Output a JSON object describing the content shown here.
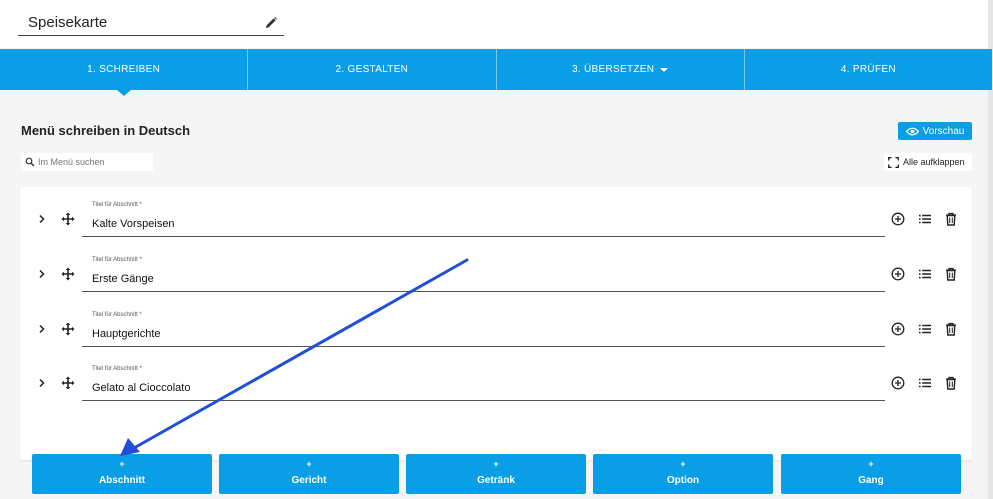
{
  "header": {
    "menu_name": "Speisekarte"
  },
  "steps": [
    {
      "label": "1. SCHREIBEN",
      "active": true
    },
    {
      "label": "2. GESTALTEN",
      "active": false
    },
    {
      "label": "3. ÜBERSETZEN",
      "active": false,
      "dropdown": true
    },
    {
      "label": "4. PRÜFEN",
      "active": false
    }
  ],
  "main": {
    "heading": "Menü schreiben in Deutsch",
    "preview_label": "Vorschau",
    "search_placeholder": "Im Menü suchen",
    "expand_all_label": "Alle aufklappen"
  },
  "sections": [
    {
      "field_label": "Titel für Abschnitt *",
      "value": "Kalte Vorspeisen"
    },
    {
      "field_label": "Titel für Abschnitt *",
      "value": "Erste Gänge"
    },
    {
      "field_label": "Titel für Abschnitt *",
      "value": "Hauptgerichte"
    },
    {
      "field_label": "Titel für Abschnitt *",
      "value": "Gelato al Cioccolato"
    }
  ],
  "add_buttons": [
    {
      "plus": "+",
      "label": "Abschnitt"
    },
    {
      "plus": "+",
      "label": "Gericht"
    },
    {
      "plus": "+",
      "label": "Getränk"
    },
    {
      "plus": "+",
      "label": "Option"
    },
    {
      "plus": "+",
      "label": "Gang"
    }
  ],
  "colors": {
    "accent": "#0a9ee6",
    "annotation_arrow": "#1f4fd8"
  },
  "icons": [
    "pencil-icon",
    "eye-icon",
    "search-icon",
    "expand-icon",
    "chevron-right-icon",
    "move-icon",
    "add-circle-icon",
    "list-icon",
    "trash-icon"
  ]
}
